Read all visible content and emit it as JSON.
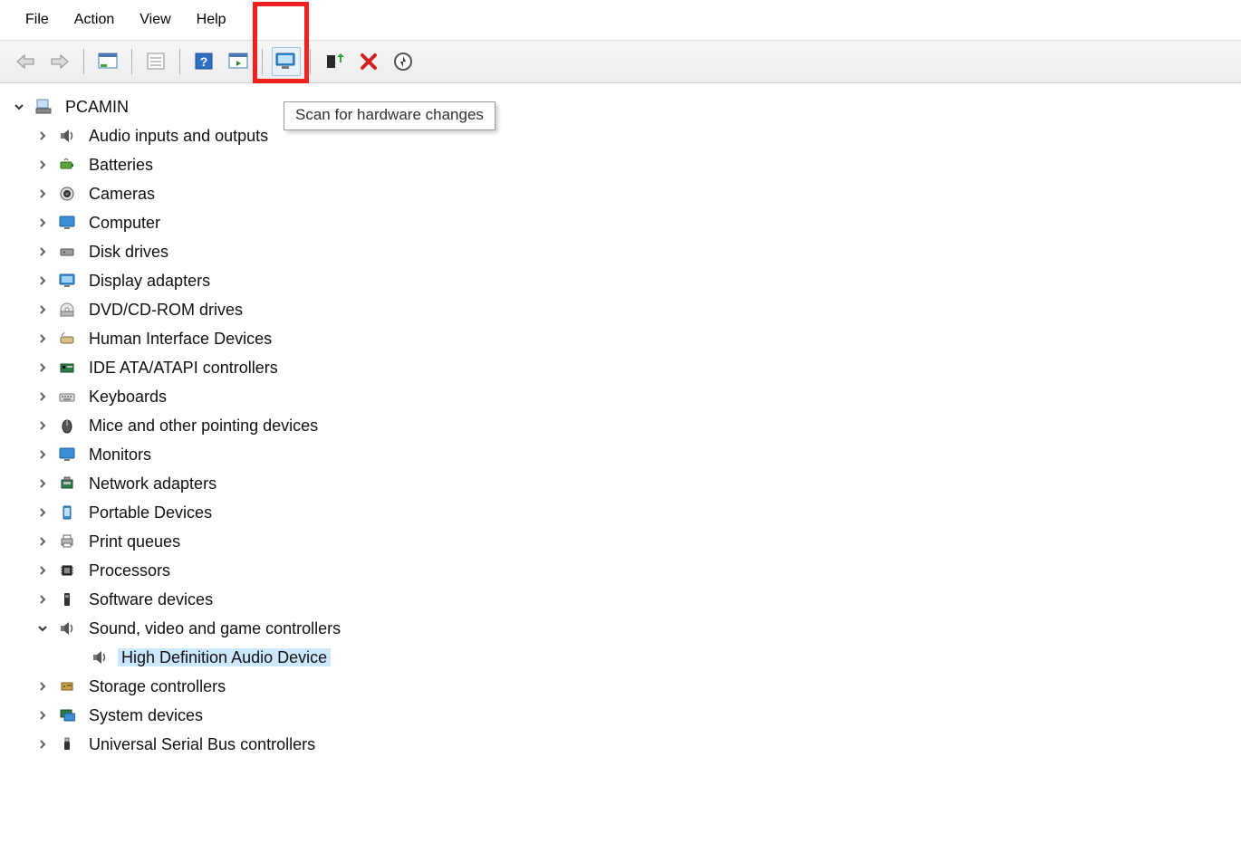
{
  "menu": {
    "file": "File",
    "action": "Action",
    "view": "View",
    "help": "Help"
  },
  "tooltip": "Scan for hardware changes",
  "root": {
    "label": "PCAMIN"
  },
  "categories": [
    {
      "label": "Audio inputs and outputs",
      "icon": "speaker"
    },
    {
      "label": "Batteries",
      "icon": "battery"
    },
    {
      "label": "Cameras",
      "icon": "camera"
    },
    {
      "label": "Computer",
      "icon": "monitor"
    },
    {
      "label": "Disk drives",
      "icon": "disk"
    },
    {
      "label": "Display adapters",
      "icon": "display"
    },
    {
      "label": "DVD/CD-ROM drives",
      "icon": "dvd"
    },
    {
      "label": "Human Interface Devices",
      "icon": "hid"
    },
    {
      "label": "IDE ATA/ATAPI controllers",
      "icon": "ide"
    },
    {
      "label": "Keyboards",
      "icon": "keyboard"
    },
    {
      "label": "Mice and other pointing devices",
      "icon": "mouse"
    },
    {
      "label": "Monitors",
      "icon": "monitor2"
    },
    {
      "label": "Network adapters",
      "icon": "network"
    },
    {
      "label": "Portable Devices",
      "icon": "portable"
    },
    {
      "label": "Print queues",
      "icon": "printer"
    },
    {
      "label": "Processors",
      "icon": "cpu"
    },
    {
      "label": "Software devices",
      "icon": "software"
    },
    {
      "label": "Sound, video and game controllers",
      "icon": "speaker",
      "expanded": true,
      "children": [
        {
          "label": "High Definition Audio Device",
          "icon": "speaker",
          "selected": true
        }
      ]
    },
    {
      "label": "Storage controllers",
      "icon": "storage"
    },
    {
      "label": "System devices",
      "icon": "system"
    },
    {
      "label": "Universal Serial Bus controllers",
      "icon": "usb"
    }
  ]
}
